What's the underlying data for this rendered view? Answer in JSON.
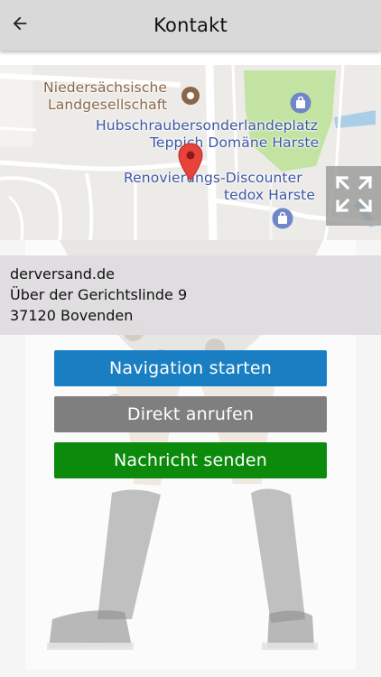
{
  "header": {
    "title": "Kontakt",
    "back_icon": "arrow-left-icon"
  },
  "map": {
    "labels": {
      "niedersachsische": "Niedersächsische",
      "landgesellschaft": "Landgesellschaft",
      "hubschrauber": "Hubschraubersonderlandeplatz",
      "teppich": "Teppich Domäne Harste",
      "renovierungs": "Renovierungs-Discounter",
      "tedox": "tedox Harste"
    },
    "icons": [
      "place-poi-icon",
      "shopping-bag-icon",
      "location-pin-icon",
      "fullscreen-icon"
    ],
    "colors": {
      "land": "#ecebe7",
      "green_area": "#c3e3a3",
      "water": "#a9cfe8",
      "pin": "#e8433a",
      "poi_blue": "#6f86c8",
      "poi_brown": "#8a6646"
    }
  },
  "address": {
    "name": "derversand.de",
    "street": "Über der Gerichtslinde 9",
    "city": "37120 Bovenden"
  },
  "buttons": {
    "navigation": "Navigation starten",
    "call": "Direkt anrufen",
    "message": "Nachricht senden"
  },
  "colors": {
    "appbar": "#d9d9d9",
    "btn_navigation": "#1a7fc2",
    "btn_call": "#7f7f7f",
    "btn_message": "#0b8a0b"
  }
}
